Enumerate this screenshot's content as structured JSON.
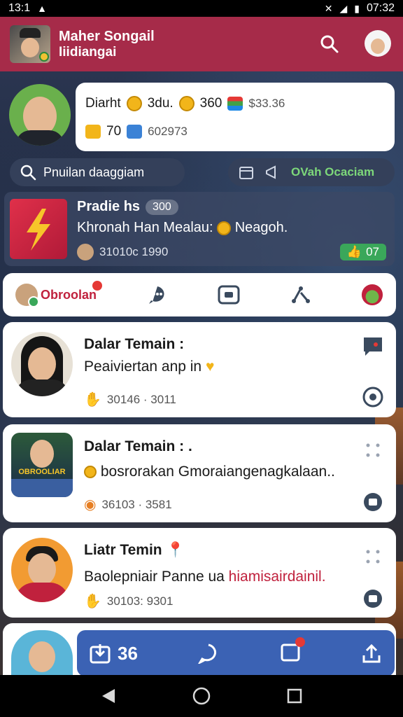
{
  "status_bar": {
    "time_left": "13:1",
    "time_right": "07:32"
  },
  "header": {
    "name": "Maher Songail",
    "subtitle": "Iiidiangai"
  },
  "profile": {
    "row1_label": "Diarht",
    "row1_a": "3du.",
    "row1_b": "360",
    "row1_c": "$33.36",
    "row2_a": "70",
    "row2_b": "602973"
  },
  "search": {
    "text": "Pnuilan daaggiam"
  },
  "action_pill": {
    "label": "OVah Ocaciam"
  },
  "featured": {
    "title": "Pradie hs",
    "badge": "300",
    "desc": "Khronah Han Mealau:",
    "desc_tail": "Neagoh.",
    "meta": "31010c 1990",
    "likes": "07"
  },
  "tabs": {
    "active_label": "Obroolan"
  },
  "chats": [
    {
      "name": "Dalar Temain :",
      "message": "Peaiviertan anp in",
      "meta": "30146 · 3011"
    },
    {
      "name": "Dalar Temain : .",
      "message": "bosrorakan Gmoraiangenagkalaan..",
      "meta": "36103 · 3581"
    },
    {
      "name": "Liatr Temin",
      "message_a": "Baolepniair Panne ua ",
      "message_b": "hiamisairdainil.",
      "meta": "30103: 9301"
    }
  ],
  "chat2_overlay": "OBROOLIAR",
  "action_bar": {
    "count": "36"
  },
  "colors": {
    "header": "#a62b49",
    "accent_red": "#c0213d",
    "action_bar": "#3b62b4",
    "green": "#3aa75a"
  }
}
